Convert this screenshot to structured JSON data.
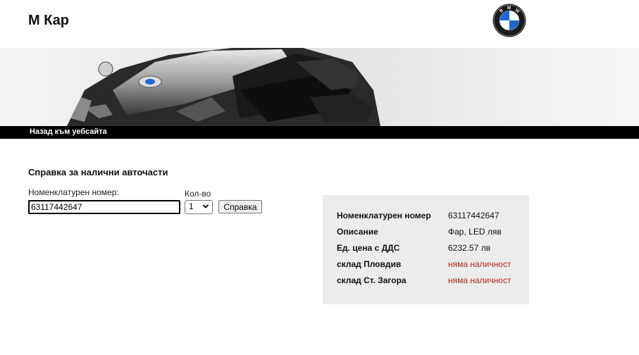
{
  "header": {
    "brand_title": "M Кар",
    "logo_text": "BMW"
  },
  "nav": {
    "back_link": "Назад към уебсайта"
  },
  "form": {
    "title": "Справка за налични авточасти",
    "part_number_label": "Номенклатурен номер:",
    "part_number_value": "63117442647",
    "qty_label": "Кол-во",
    "qty_value": "1",
    "submit_label": "Справка"
  },
  "result": {
    "rows": [
      {
        "label": "Номенклатурен номер",
        "value": "63117442647"
      },
      {
        "label": "Описание",
        "value": "Фар, LED ляв"
      },
      {
        "label": "Ед. цена с ДДС",
        "value": "6232.57 лв"
      },
      {
        "label": "склад Пловдив",
        "value": "няма наличност"
      },
      {
        "label": "склад Ст. Загора",
        "value": "няма наличност"
      }
    ]
  },
  "colors": {
    "out_of_stock": "#b22222",
    "panel_bg": "#ececec",
    "nav_bg": "#000000"
  }
}
